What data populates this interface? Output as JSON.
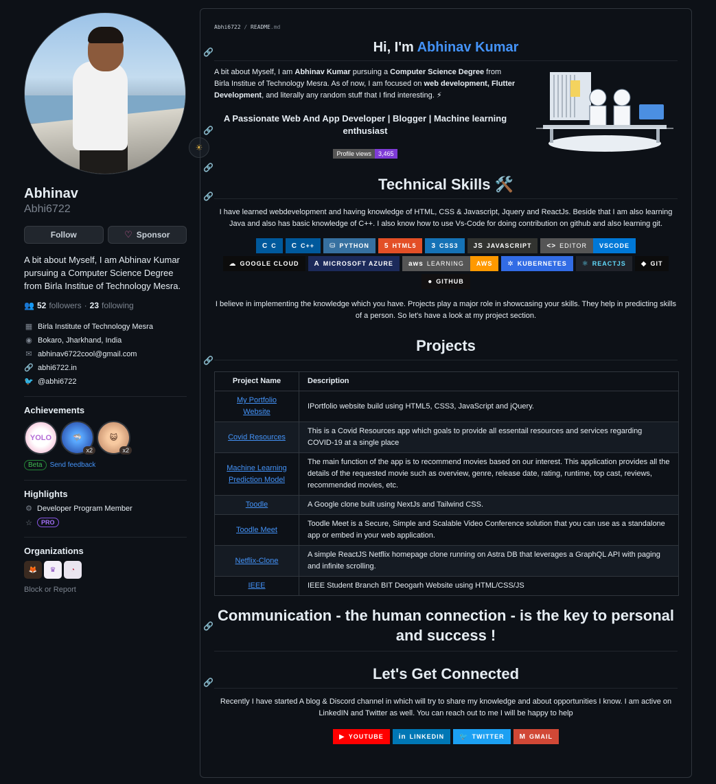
{
  "profile": {
    "display_name": "Abhinav",
    "login": "Abhi6722",
    "status_emoji": "☀",
    "follow_label": "Follow",
    "sponsor_label": "Sponsor",
    "bio": "A bit about Myself, I am Abhinav Kumar pursuing a Computer Science Degree from Birla Institue of Technology Mesra.",
    "followers_count": "52",
    "followers_label": "followers",
    "dot": "·",
    "following_count": "23",
    "following_label": "following",
    "organization": "Birla Institute of Technology Mesra",
    "location": "Bokaro, Jharkhand, India",
    "email": "abhinav6722cool@gmail.com",
    "website": "abhi6722.in",
    "twitter": "@abhi6722"
  },
  "achievements": {
    "heading": "Achievements",
    "badges": [
      {
        "name": "YOLO",
        "count": ""
      },
      {
        "name": "Pull Shark",
        "count": "x2"
      },
      {
        "name": "Starstruck",
        "count": "x2"
      }
    ],
    "beta_label": "Beta",
    "feedback_label": "Send feedback"
  },
  "highlights": {
    "heading": "Highlights",
    "items": [
      "Developer Program Member"
    ],
    "pro_label": "PRO"
  },
  "organizations": {
    "heading": "Organizations",
    "block_label": "Block or Report"
  },
  "readme": {
    "breadcrumb_owner": "Abhi6722",
    "breadcrumb_sep": "/",
    "breadcrumb_file": "README",
    "breadcrumb_ext": ".md",
    "greeting_prefix": "Hi, I'm",
    "greeting_name": "Abhinav Kumar",
    "intro": {
      "t1": "A bit about Myself, I am ",
      "b1": "Abhinav Kumar",
      "t2": " pursuing a ",
      "b2": "Computer Science Degree",
      "t3": " from Birla Institue of Technology Mesra. As of now, I am focused on ",
      "b3": "web development, Flutter Development",
      "t4": ", and literally any random stuff that I find interesting. ⚡"
    },
    "passion": "A Passionate Web And App Developer | Blogger | Machine learning enthusiast",
    "profile_views_label": "Profile views",
    "profile_views_value": "3,465",
    "skills_heading": "Technical Skills 🛠️",
    "skills_text": "I have learned webdevelopment and having knowledge of HTML, CSS & Javascript, Jquery and ReactJs. Beside that I am also learning Java and also has basic knowledge of C++. I also know how to use Vs-Code for doing contribution on github and also learning git.",
    "skills": [
      {
        "label": "C",
        "icon": "C",
        "bg": "#00599c"
      },
      {
        "label": "C++",
        "icon": "C",
        "bg": "#00599c"
      },
      {
        "label": "PYTHON",
        "icon": "⛁",
        "bg": "#3670a0"
      },
      {
        "label": "HTML5",
        "icon": "5",
        "bg": "#e34f26"
      },
      {
        "label": "CSS3",
        "icon": "3",
        "bg": "#1572b6"
      },
      {
        "label": "JAVASCRIPT",
        "icon": "JS",
        "bg": "#323330"
      },
      {
        "label": "EDITOR",
        "icon": "<>",
        "bg": "#555555",
        "label2": "VSCODE",
        "bg2": "#0078d7"
      },
      {
        "label": "GOOGLE CLOUD",
        "icon": "☁",
        "bg": "#0c0c0c"
      },
      {
        "label": "MICROSOFT AZURE",
        "icon": "A",
        "bg": "#1c2a5a"
      },
      {
        "label": "LEARNING",
        "icon": "aws",
        "bg": "#555555",
        "label2": "AWS",
        "bg2": "#ff9900"
      },
      {
        "label": "KUBERNETES",
        "icon": "✲",
        "bg": "#326ce5"
      },
      {
        "label": "REACTJS",
        "icon": "⚛",
        "bg": "#20232a",
        "fg": "#61dafb"
      },
      {
        "label": "GIT",
        "icon": "◆",
        "bg": "#0c0c0c"
      },
      {
        "label": "GITHUB",
        "icon": "●",
        "bg": "#121011"
      }
    ],
    "projects_intro": "I believe in implementing the knowledge which you have. Projects play a major role in showcasing your skills. They help in predicting skills of a person. So let's have a look at my project section.",
    "projects_heading": "Projects",
    "table_headers": [
      "Project Name",
      "Description"
    ],
    "projects": [
      {
        "name": "My Portfolio Website",
        "desc": "IPortfolio website build using HTML5, CSS3, JavaScript and jQuery."
      },
      {
        "name": "Covid Resources",
        "desc": "This is a Covid Resources app which goals to provide all essentail resources and services regarding COVID-19 at a single place"
      },
      {
        "name": "Machine Learning Prediction Model",
        "desc": "The main function of the app is to recommend movies based on our interest. This application provides all the details of the requested movie such as overview, genre, release date, rating, runtime, top cast, reviews, recommended movies, etc."
      },
      {
        "name": "Toodle",
        "desc": "A Google clone built using NextJs and Tailwind CSS."
      },
      {
        "name": "Toodle Meet",
        "desc": "Toodle Meet is a Secure, Simple and Scalable Video Conference solution that you can use as a standalone app or embed in your web application."
      },
      {
        "name": "Netflix-Clone",
        "desc": "A simple ReactJS Netflix homepage clone running on Astra DB that leverages a GraphQL API with paging and infinite scrolling."
      },
      {
        "name": "IEEE",
        "desc": "IEEE Student Branch BIT Deogarh Website using HTML/CSS/JS"
      }
    ],
    "quote": "Communication - the human connection - is the key to personal and success !",
    "connect_heading": "Let's Get Connected",
    "connect_text": "Recently I have started A blog & Discord channel in which will try to share my knowledge and about opportunities I know. I am active on LinkedIN and Twitter as well. You can reach out to me I will be happy to help",
    "socials": [
      {
        "label": "YOUTUBE",
        "icon": "▶",
        "bg": "#ff0000"
      },
      {
        "label": "LINKEDIN",
        "icon": "in",
        "bg": "#0077b5"
      },
      {
        "label": "TWITTER",
        "icon": "🐦",
        "bg": "#1ca0f2"
      },
      {
        "label": "GMAIL",
        "icon": "M",
        "bg": "#d14836"
      }
    ]
  },
  "colors": {
    "background": "#0d1117",
    "accent": "#4493f8",
    "border": "#30363d"
  }
}
